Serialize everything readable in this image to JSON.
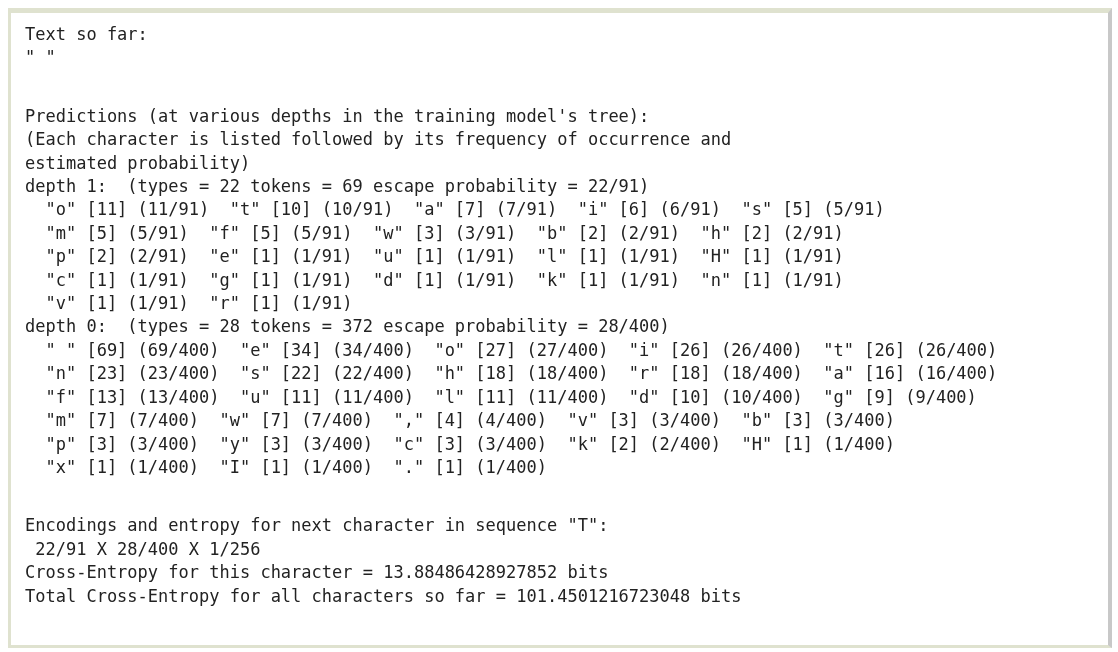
{
  "output": {
    "blocks": [
      {
        "lines": [
          {
            "kind": "line",
            "text": "Text so far:"
          },
          {
            "kind": "line",
            "text": "\" \""
          }
        ]
      },
      {
        "lines": [
          {
            "kind": "line",
            "text": "Predictions (at various depths in the training model's tree):"
          },
          {
            "kind": "line",
            "text": "(Each character is listed followed by its frequency of occurrence and"
          },
          {
            "kind": "line",
            "text": "estimated probability)"
          },
          {
            "kind": "line",
            "text": "depth 1:  (types = 22 tokens = 69 escape probability = 22/91)"
          },
          {
            "kind": "entries",
            "text": "\"o\" [11] (11/91)  \"t\" [10] (10/91)  \"a\" [7] (7/91)  \"i\" [6] (6/91)  \"s\" [5] (5/91)"
          },
          {
            "kind": "entries",
            "text": "\"m\" [5] (5/91)  \"f\" [5] (5/91)  \"w\" [3] (3/91)  \"b\" [2] (2/91)  \"h\" [2] (2/91)"
          },
          {
            "kind": "entries",
            "text": "\"p\" [2] (2/91)  \"e\" [1] (1/91)  \"u\" [1] (1/91)  \"l\" [1] (1/91)  \"H\" [1] (1/91)"
          },
          {
            "kind": "entries",
            "text": "\"c\" [1] (1/91)  \"g\" [1] (1/91)  \"d\" [1] (1/91)  \"k\" [1] (1/91)  \"n\" [1] (1/91)"
          },
          {
            "kind": "entries",
            "text": "\"v\" [1] (1/91)  \"r\" [1] (1/91)"
          },
          {
            "kind": "line",
            "text": "depth 0:  (types = 28 tokens = 372 escape probability = 28/400)"
          },
          {
            "kind": "entries",
            "text": "\" \" [69] (69/400)  \"e\" [34] (34/400)  \"o\" [27] (27/400)  \"i\" [26] (26/400)  \"t\" [26] (26/400)"
          },
          {
            "kind": "entries",
            "text": "\"n\" [23] (23/400)  \"s\" [22] (22/400)  \"h\" [18] (18/400)  \"r\" [18] (18/400)  \"a\" [16] (16/400)"
          },
          {
            "kind": "entries",
            "text": "\"f\" [13] (13/400)  \"u\" [11] (11/400)  \"l\" [11] (11/400)  \"d\" [10] (10/400)  \"g\" [9] (9/400)"
          },
          {
            "kind": "entries",
            "text": "\"m\" [7] (7/400)  \"w\" [7] (7/400)  \",\" [4] (4/400)  \"v\" [3] (3/400)  \"b\" [3] (3/400)"
          },
          {
            "kind": "entries",
            "text": "\"p\" [3] (3/400)  \"y\" [3] (3/400)  \"c\" [3] (3/400)  \"k\" [2] (2/400)  \"H\" [1] (1/400)"
          },
          {
            "kind": "entries",
            "text": "\"x\" [1] (1/400)  \"I\" [1] (1/400)  \".\" [1] (1/400)"
          }
        ]
      },
      {
        "lines": [
          {
            "kind": "line",
            "text": "Encodings and entropy for next character in sequence \"T\":"
          },
          {
            "kind": "formula",
            "text": "22/91 X 28/400 X 1/256"
          },
          {
            "kind": "line",
            "text": "Cross-Entropy for this character = 13.88486428927852 bits"
          },
          {
            "kind": "line",
            "text": "Total Cross-Entropy for all characters so far = 101.4501216723048 bits"
          }
        ]
      }
    ]
  }
}
